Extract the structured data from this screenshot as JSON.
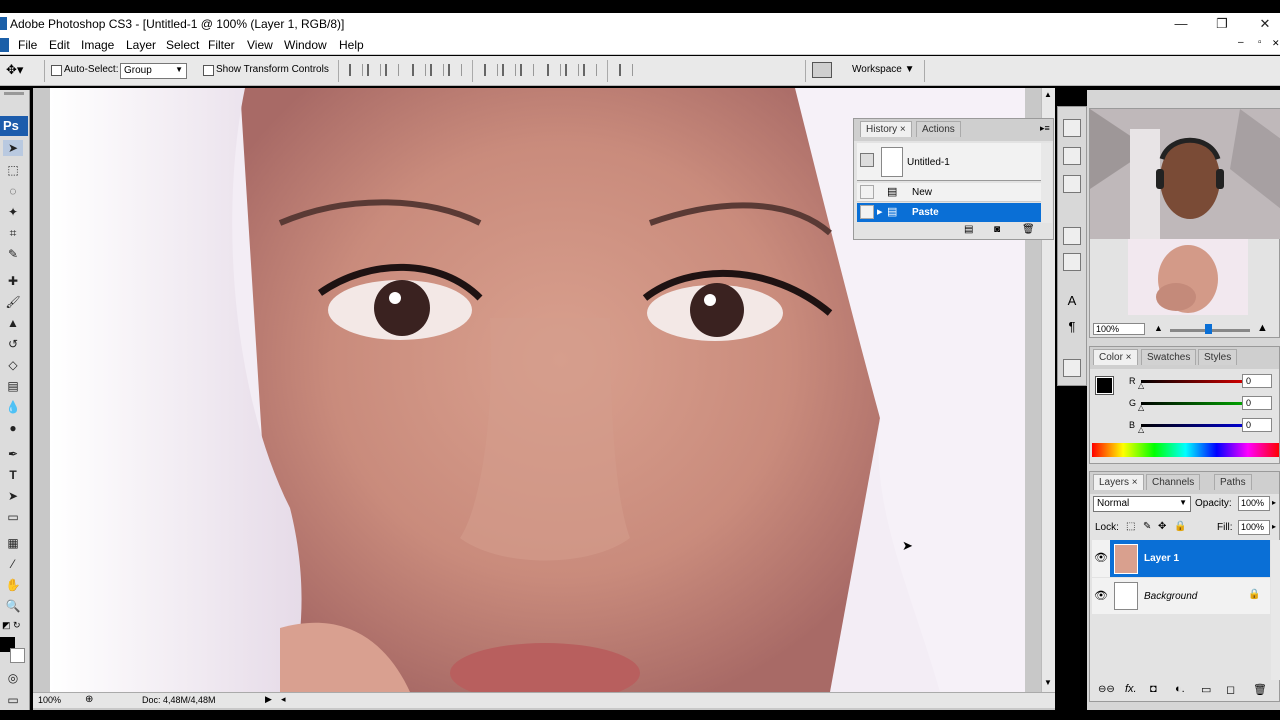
{
  "window": {
    "title": "Adobe Photoshop CS3 - [Untitled-1 @ 100% (Layer 1, RGB/8)]",
    "controls": {
      "minimize": "—",
      "restore": "❐",
      "close": "✕"
    },
    "doc_controls": {
      "minimize": "–",
      "restore": "▫",
      "close": "✕"
    }
  },
  "menu": [
    "File",
    "Edit",
    "Image",
    "Layer",
    "Select",
    "Filter",
    "View",
    "Window",
    "Help"
  ],
  "options": {
    "auto_select_label": "Auto-Select:",
    "auto_select_value": "Group",
    "show_transform_label": "Show Transform Controls",
    "workspace_label": "Workspace ▼"
  },
  "toolbox": {
    "logo": "Ps",
    "tools": [
      "move",
      "marquee",
      "lasso",
      "magic-wand",
      "crop",
      "slice",
      "healing",
      "brush",
      "stamp",
      "history-brush",
      "eraser",
      "gradient",
      "blur",
      "dodge",
      "pen",
      "type",
      "path-select",
      "shape",
      "notes",
      "eyedropper",
      "hand",
      "zoom"
    ],
    "fg_color": "#000000",
    "bg_color": "#ffffff"
  },
  "status": {
    "zoom": "100%",
    "doc": "Doc: 4,48M/4,48M"
  },
  "history": {
    "tabs": [
      "History",
      "Actions"
    ],
    "snapshot": "Untitled-1",
    "items": [
      "New",
      "Paste"
    ],
    "selected": "Paste"
  },
  "navigator": {
    "zoom": "100%"
  },
  "color": {
    "tabs": [
      "Color",
      "Swatches",
      "Styles"
    ],
    "channels": [
      {
        "label": "R",
        "value": "0",
        "color": "#e00000"
      },
      {
        "label": "G",
        "value": "0",
        "color": "#00b000"
      },
      {
        "label": "B",
        "value": "0",
        "color": "#0000e0"
      }
    ]
  },
  "layers": {
    "tabs": [
      "Layers",
      "Channels",
      "Paths"
    ],
    "blend_mode": "Normal",
    "opacity_label": "Opacity:",
    "opacity_value": "100%",
    "lock_label": "Lock:",
    "fill_label": "Fill:",
    "fill_value": "100%",
    "items": [
      {
        "name": "Layer 1",
        "selected": true
      },
      {
        "name": "Background",
        "selected": false
      }
    ]
  },
  "accent": "#0a6fd6"
}
